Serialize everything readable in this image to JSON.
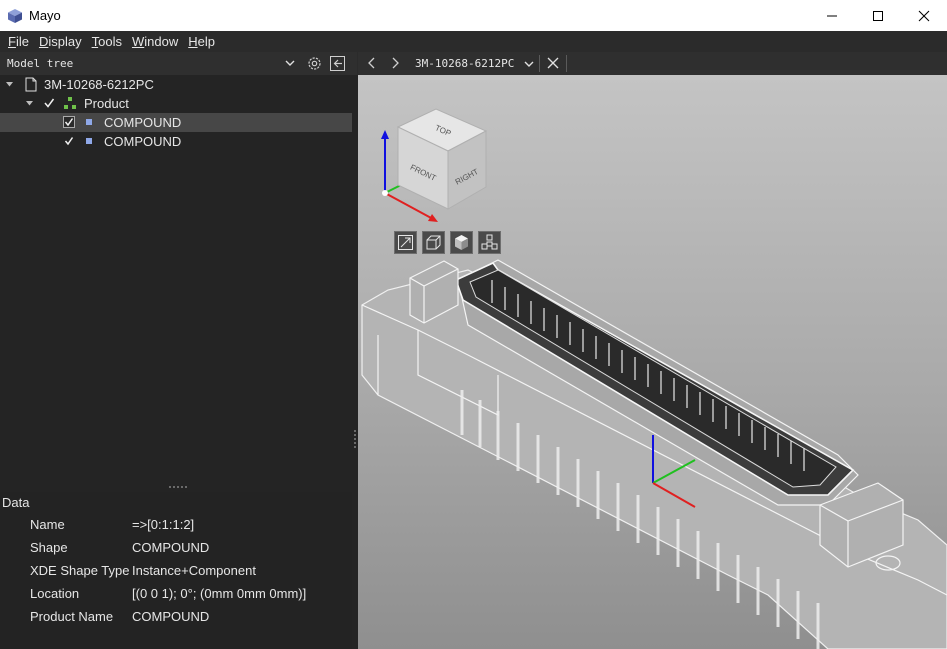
{
  "window": {
    "title": "Mayo"
  },
  "menu": [
    {
      "key": "F",
      "rest": "ile"
    },
    {
      "key": "D",
      "rest": "isplay"
    },
    {
      "key": "T",
      "rest": "ools"
    },
    {
      "key": "W",
      "rest": "indow"
    },
    {
      "key": "H",
      "rest": "elp"
    }
  ],
  "left_panel": {
    "combo_value": "Model tree"
  },
  "tree": {
    "root": "3M-10268-6212PC",
    "product": "Product",
    "items": [
      "COMPOUND",
      "COMPOUND"
    ]
  },
  "data_panel": {
    "title": "Data",
    "rows": [
      {
        "key": "Name",
        "value": "=>[0:1:1:2]"
      },
      {
        "key": "Shape",
        "value": "COMPOUND"
      },
      {
        "key": "XDE Shape Type",
        "value": "Instance+Component"
      },
      {
        "key": "Location",
        "value": "[(0 0 1); 0°; (0mm 0mm 0mm)]"
      },
      {
        "key": "Product Name",
        "value": "COMPOUND"
      }
    ]
  },
  "document": {
    "name": "3M-10268-6212PC"
  },
  "view_cube": {
    "top": "TOP",
    "front": "FRONT",
    "right": "RIGHT"
  },
  "colors": {
    "accent_selection": "#474747",
    "x_axis": "#e02020",
    "y_axis": "#20c020",
    "z_axis": "#1010e0"
  }
}
